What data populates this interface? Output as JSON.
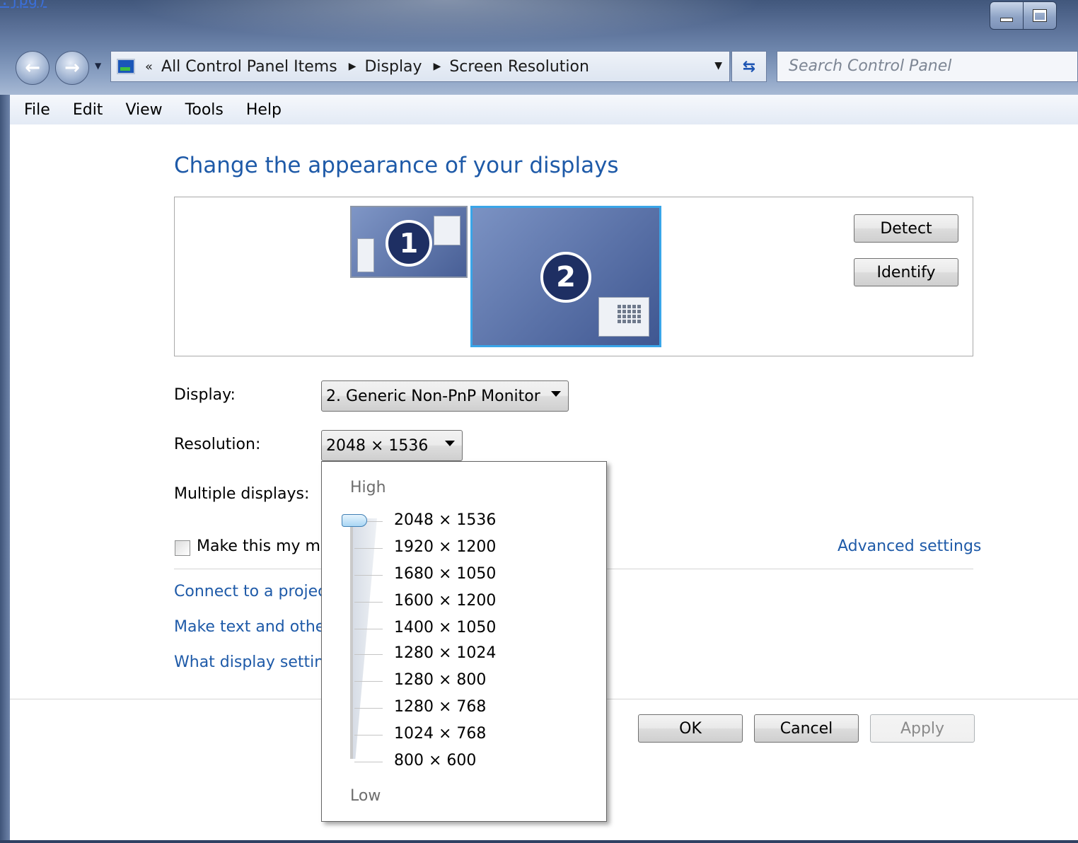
{
  "top_link": ".jpg)",
  "address_bar": {
    "overflow_chevrons": "«",
    "crumbs": [
      "All Control Panel Items",
      "Display",
      "Screen Resolution"
    ],
    "search_placeholder": "Search Control Panel"
  },
  "menu": [
    "File",
    "Edit",
    "View",
    "Tools",
    "Help"
  ],
  "page": {
    "title": "Change the appearance of your displays",
    "monitor_1": "1",
    "monitor_2": "2",
    "detect": "Detect",
    "identify": "Identify",
    "display_label": "Display:",
    "display_value": "2. Generic Non-PnP Monitor",
    "resolution_label": "Resolution:",
    "resolution_value": "2048 × 1536",
    "multiple_label": "Multiple displays:",
    "main_checkbox_label": "Make this my ma",
    "advanced_link": "Advanced settings",
    "link_projector": "Connect to a projec",
    "link_text_size": "Make text and other",
    "link_what": "What display setting",
    "ok": "OK",
    "cancel": "Cancel",
    "apply": "Apply"
  },
  "resolution_popup": {
    "high_label": "High",
    "low_label": "Low",
    "options": [
      "2048 × 1536",
      "1920 × 1200",
      "1680 × 1050",
      "1600 × 1200",
      "1400 × 1050",
      "1280 × 1024",
      "1280 × 800",
      "1280 × 768",
      "1024 × 768",
      "800 × 600"
    ],
    "selected_index": 0
  },
  "colors": {
    "link_blue": "#1e5aa8",
    "selected_monitor_border": "#39a5e8"
  }
}
